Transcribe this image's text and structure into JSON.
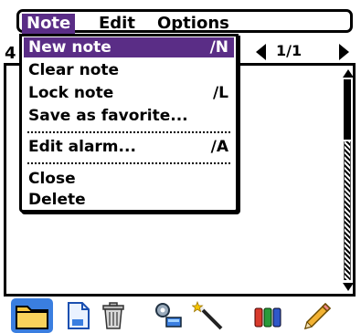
{
  "menubar": {
    "titles": {
      "note": "Note",
      "edit": "Edit",
      "options": "Options"
    }
  },
  "note_menu": {
    "items": [
      {
        "label": "New note",
        "shortcut": "∕N"
      },
      {
        "label": "Clear note",
        "shortcut": ""
      },
      {
        "label": "Lock note",
        "shortcut": "∕L"
      },
      {
        "label": "Save as favorite...",
        "shortcut": ""
      },
      {
        "label": "Edit alarm...",
        "shortcut": "∕A"
      },
      {
        "label": "Close",
        "shortcut": ""
      },
      {
        "label": "Delete",
        "shortcut": ""
      }
    ],
    "selected_index": 0
  },
  "form": {
    "behind_char": "4",
    "pager_text": "1/1"
  },
  "colors": {
    "highlight": "#5a2d86",
    "toolbar_selected": "#3a7ee0"
  },
  "toolbar": {
    "icons": [
      "folder-icon",
      "new-page-icon",
      "trash-icon",
      "tools-icon",
      "magic-wand-icon",
      "color-pens-icon",
      "pencil-icon"
    ]
  }
}
